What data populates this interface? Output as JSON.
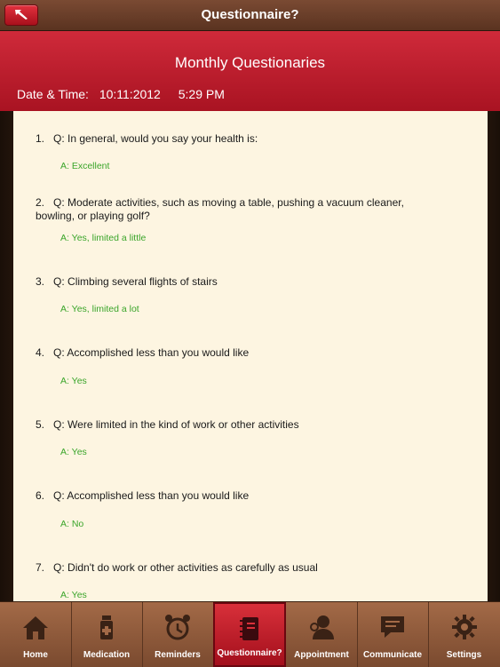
{
  "nav": {
    "title": "Questionnaire?"
  },
  "header": {
    "title": "Monthly Questionaries",
    "datetime_label": "Date & Time:",
    "date": "10:11:2012",
    "time": "5:29 PM"
  },
  "questions": [
    {
      "num": "1.",
      "q": "Q: In general, would you say your health is:",
      "a": "A: Excellent"
    },
    {
      "num": "2.",
      "q": "Q: Moderate activities, such as moving a table, pushing a vacuum cleaner, bowling, or playing golf?",
      "a": "A: Yes, limited a little"
    },
    {
      "num": "3.",
      "q": "Q: Climbing several flights of stairs",
      "a": "A: Yes, limited a lot"
    },
    {
      "num": "4.",
      "q": "Q: Accomplished less than you would like",
      "a": "A: Yes"
    },
    {
      "num": "5.",
      "q": "Q: Were limited in the kind of work or other activities",
      "a": "A: Yes"
    },
    {
      "num": "6.",
      "q": "Q: Accomplished less than you would like",
      "a": "A: No"
    },
    {
      "num": "7.",
      "q": "Q: Didn't do work or other activities as carefully as usual",
      "a": "A: Yes"
    }
  ],
  "tabs": [
    {
      "label": "Home",
      "icon": "home-icon"
    },
    {
      "label": "Medication",
      "icon": "pill-bottle-icon"
    },
    {
      "label": "Reminders",
      "icon": "alarm-clock-icon"
    },
    {
      "label": "Questionnaire?",
      "icon": "notebook-icon",
      "active": true
    },
    {
      "label": "Appointment",
      "icon": "doctor-icon"
    },
    {
      "label": "Communicate",
      "icon": "chat-icon"
    },
    {
      "label": "Settings",
      "icon": "gear-icon"
    }
  ],
  "colors": {
    "accent": "#c61e2e",
    "answer": "#3aa52a",
    "panel": "#fdf5e1"
  }
}
